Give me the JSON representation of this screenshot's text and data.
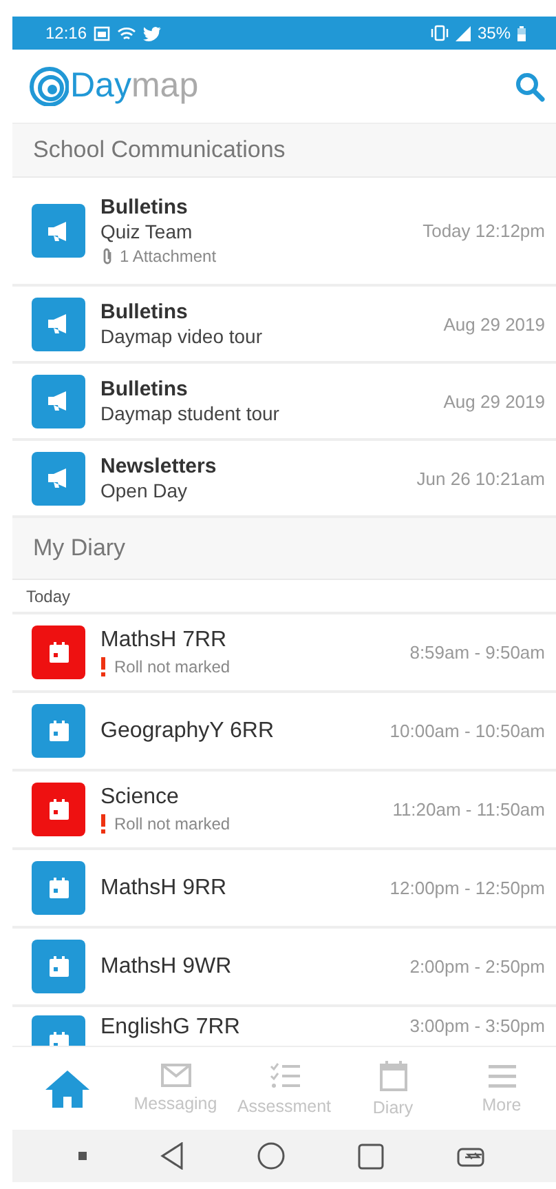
{
  "status_bar": {
    "time": "12:16",
    "battery": "35%"
  },
  "app_bar": {
    "logo_text_1": "Day",
    "logo_text_2": "map"
  },
  "communications": {
    "title": "School Communications",
    "items": [
      {
        "title": "Bulletins",
        "subtitle": "Quiz Team",
        "attachment": "1 Attachment",
        "date": "Today 12:12pm"
      },
      {
        "title": "Bulletins",
        "subtitle": "Daymap video tour",
        "date": "Aug 29 2019"
      },
      {
        "title": "Bulletins",
        "subtitle": "Daymap student tour",
        "date": "Aug 29 2019"
      },
      {
        "title": "Newsletters",
        "subtitle": "Open Day",
        "date": "Jun 26 10:21am"
      }
    ]
  },
  "diary": {
    "title": "My Diary",
    "day": "Today",
    "items": [
      {
        "title": "MathsH 7RR",
        "alert": "Roll not marked",
        "time": "8:59am - 9:50am",
        "color": "#ee1111"
      },
      {
        "title": "GeographyY 6RR",
        "time": "10:00am - 10:50am",
        "color": "#2198d6"
      },
      {
        "title": "Science",
        "alert": "Roll not marked",
        "time": "11:20am - 11:50am",
        "color": "#ee1111"
      },
      {
        "title": "MathsH 9RR",
        "time": "12:00pm - 12:50pm",
        "color": "#2198d6"
      },
      {
        "title": "MathsH 9WR",
        "time": "2:00pm - 2:50pm",
        "color": "#2198d6"
      },
      {
        "title": "EnglishG 7RR",
        "time": "3:00pm - 3:50pm",
        "color": "#2198d6"
      }
    ]
  },
  "tabs": [
    {
      "kind": "home",
      "selected": true
    },
    {
      "kind": "mail",
      "label": "Messaging",
      "selected": false
    },
    {
      "kind": "checklist",
      "label": "Assessment",
      "selected": false
    },
    {
      "kind": "calendar",
      "label": "Diary",
      "selected": false
    },
    {
      "kind": "menu",
      "label": "More",
      "selected": false
    }
  ]
}
